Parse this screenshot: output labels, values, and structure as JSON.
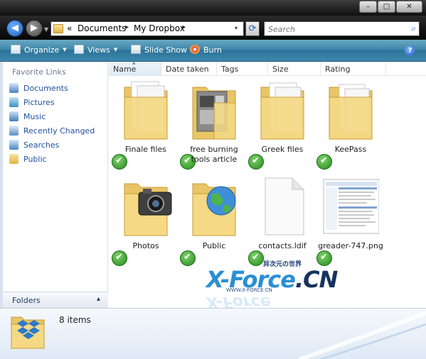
{
  "window": {
    "minimize_glyph": "–",
    "maximize_glyph": "□",
    "close_glyph": "✕"
  },
  "address_bar": {
    "overflow_glyph": "«",
    "crumbs": [
      "Documents",
      "My Dropbox"
    ],
    "separator_glyph": "▸",
    "dropdown_glyph": "▾"
  },
  "search": {
    "placeholder": "Search",
    "icon": "search-icon"
  },
  "toolbar": {
    "organize": "Organize",
    "views": "Views",
    "slideshow": "Slide Show",
    "burn": "Burn",
    "help": "?"
  },
  "nav_pane": {
    "title": "Favorite Links",
    "items": [
      {
        "label": "Documents",
        "icon": "documents-icon",
        "color": "#4a7fc4"
      },
      {
        "label": "Pictures",
        "icon": "pictures-icon",
        "color": "#3b8fbf"
      },
      {
        "label": "Music",
        "icon": "music-icon",
        "color": "#3e7db8"
      },
      {
        "label": "Recently Changed",
        "icon": "recently-changed-icon",
        "color": "#5a8ac6"
      },
      {
        "label": "Searches",
        "icon": "searches-icon",
        "color": "#4b86c2"
      },
      {
        "label": "Public",
        "icon": "public-folder-icon",
        "color": "#e2b447"
      }
    ],
    "folders_label": "Folders",
    "folders_chevron": "▴"
  },
  "columns": [
    {
      "label": "Name",
      "sorted": true
    },
    {
      "label": "Date taken",
      "sorted": false
    },
    {
      "label": "Tags",
      "sorted": false
    },
    {
      "label": "Size",
      "sorted": false
    },
    {
      "label": "Rating",
      "sorted": false
    }
  ],
  "files": [
    {
      "name": "Finale files",
      "type": "folder-docs",
      "synced": true
    },
    {
      "name": "free burning tools article",
      "type": "folder-screens",
      "synced": true
    },
    {
      "name": "Greek files",
      "type": "folder-docs",
      "synced": true
    },
    {
      "name": "KeePass",
      "type": "folder-docs",
      "synced": true
    },
    {
      "name": "Photos",
      "type": "folder-camera",
      "synced": true
    },
    {
      "name": "Public",
      "type": "folder-globe",
      "synced": true
    },
    {
      "name": "contacts.ldif",
      "type": "file-blank",
      "synced": true
    },
    {
      "name": "greader-747.png",
      "type": "image-thumb",
      "synced": true
    }
  ],
  "watermark": {
    "chinese": "异次元の世界",
    "logo_left": "X-Force",
    "logo_right": ".CN",
    "url": "WWW.X-FORCE.CN"
  },
  "details": {
    "item_count": "8 items"
  },
  "colors": {
    "toolbar_top": "#6aa8c3",
    "toolbar_bottom": "#2d7398",
    "link_blue": "#1f4f9e",
    "folder_yellow": "#f3d27a",
    "sync_green": "#23891c"
  }
}
